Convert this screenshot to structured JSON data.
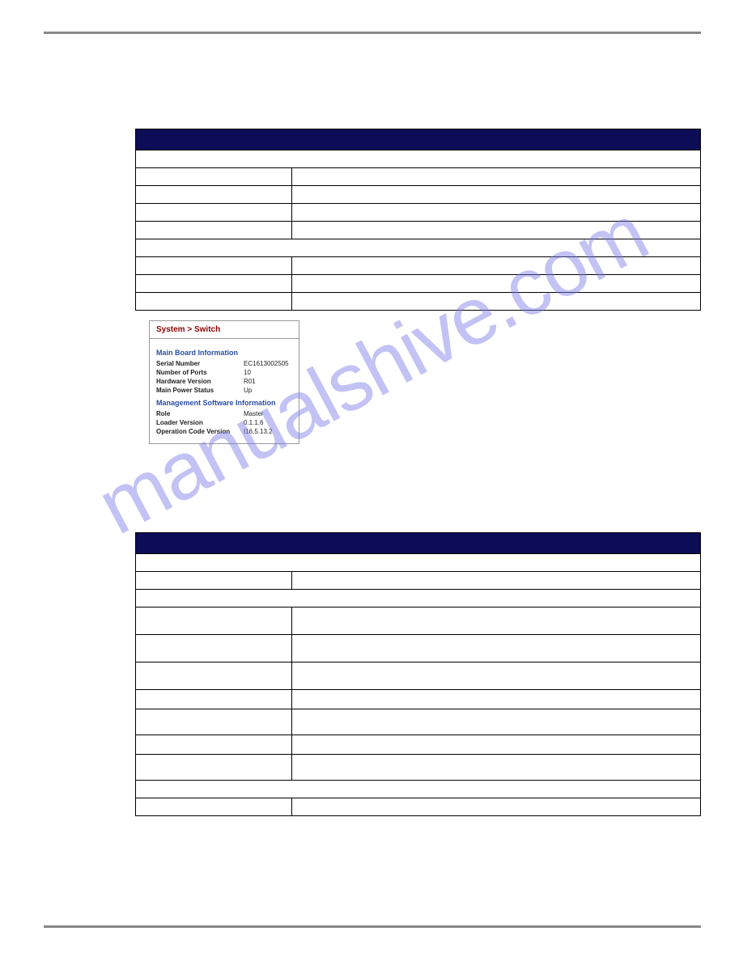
{
  "watermark": "manualshive.com",
  "figure": {
    "breadcrumb": "System > Switch",
    "section1": "Main Board Information",
    "rows1": [
      {
        "k": "Serial Number",
        "v": "EC1613002505"
      },
      {
        "k": "Number of Ports",
        "v": "10"
      },
      {
        "k": "Hardware Version",
        "v": "R01"
      },
      {
        "k": "Main Power Status",
        "v": "Up"
      }
    ],
    "section2": "Management Software Information",
    "rows2": [
      {
        "k": "Role",
        "v": "Master"
      },
      {
        "k": "Loader Version",
        "v": "0.1.1.6"
      },
      {
        "k": "Operation Code Version",
        "v": "I16.5.13.2"
      }
    ]
  }
}
